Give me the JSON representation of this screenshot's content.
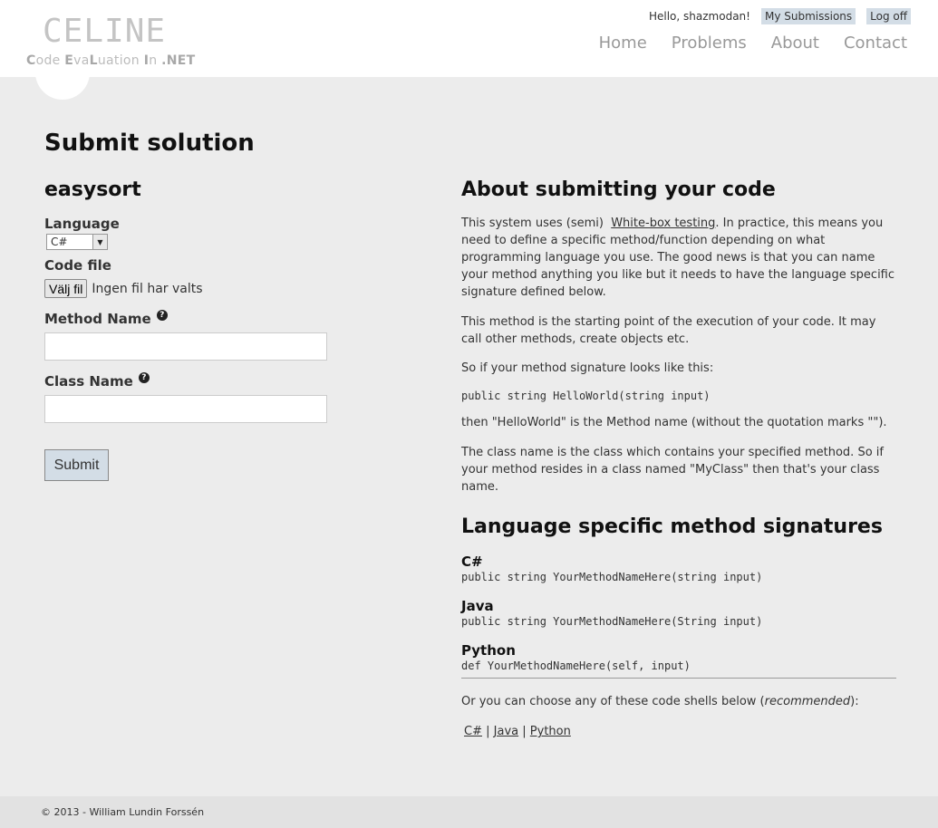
{
  "header": {
    "logo_title": "CELINE",
    "logo_sub_letters": [
      "C",
      "ode ",
      "E",
      "va",
      "L",
      "uation ",
      "I",
      "n ",
      ".NET"
    ],
    "greeting": "Hello, shazmodan!",
    "my_submissions": "My Submissions",
    "log_off": "Log off",
    "nav": [
      "Home",
      "Problems",
      "About",
      "Contact"
    ]
  },
  "page_title": "Submit solution",
  "form": {
    "problem_name": "easysort",
    "language_label": "Language",
    "language_value": "C#",
    "code_file_label": "Code file",
    "file_button": "Välj fil",
    "file_status": "Ingen fil har valts",
    "method_name_label": "Method Name",
    "class_name_label": "Class Name",
    "help_icon": "question-icon",
    "submit_label": "Submit"
  },
  "about": {
    "title": "About submitting your code",
    "p1_prefix": "This system uses (semi)",
    "p1_link": "White-box testing",
    "p1_suffix": ". In practice, this means you need to define a specific method/function depending on what programming language you use. The good news is that you can name your method anything you like but it needs to have the language specific signature defined below.",
    "p2": "This method is the starting point of the execution of your code. It may call other methods, create objects etc.",
    "p3": "So if your method signature looks like this:",
    "example_code": "public string HelloWorld(string input)",
    "p4": "then \"HelloWorld\" is the Method name (without the quotation marks \"\").",
    "p5": "The class name is the class which contains your specified method. So if your method resides in a class named \"MyClass\" then that's your class name."
  },
  "signatures": {
    "title": "Language specific method signatures",
    "items": [
      {
        "lang": "C#",
        "code": "public string YourMethodNameHere(string input)"
      },
      {
        "lang": "Java",
        "code": "public string YourMethodNameHere(String input)"
      },
      {
        "lang": "Python",
        "code": "def YourMethodNameHere(self, input)"
      }
    ],
    "shells_prefix": "Or you can choose any of these code shells below (",
    "shells_em": "recommended",
    "shells_suffix": "):",
    "shell_links": [
      "C#",
      "Java",
      "Python"
    ],
    "separator": "|"
  },
  "footer": "© 2013 - William Lundin Forssén"
}
